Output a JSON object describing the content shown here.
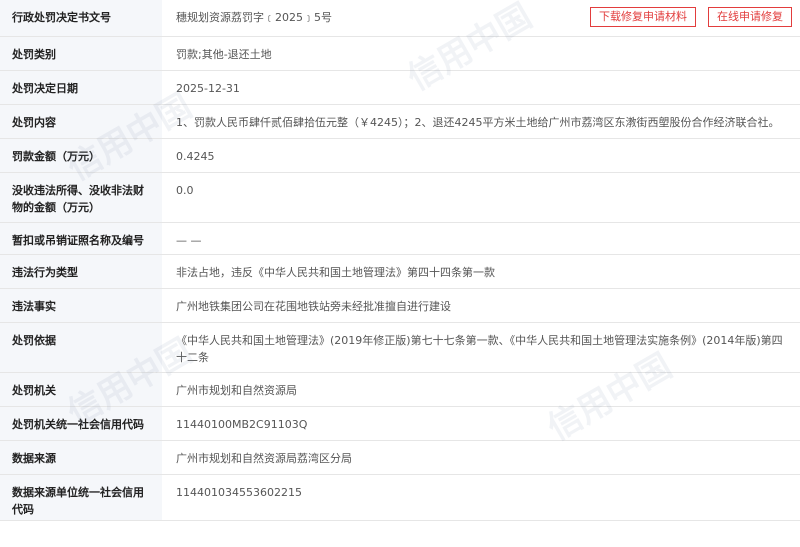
{
  "buttons": {
    "download_repair": "下载修复申请材料",
    "online_repair": "在线申请修复"
  },
  "rows": [
    {
      "label": "行政处罚决定书文号",
      "value": "穗规划资源荔罚字﹝2025﹞5号"
    },
    {
      "label": "处罚类别",
      "value": "罚款;其他-退还土地"
    },
    {
      "label": "处罚决定日期",
      "value": "2025-12-31"
    },
    {
      "label": "处罚内容",
      "value": "1、罚款人民币肆仟贰佰肆拾伍元整（￥4245）；2、退还4245平方米土地给广州市荔湾区东漖街西塱股份合作经济联合社。"
    },
    {
      "label": "罚款金额（万元）",
      "value": "0.4245"
    },
    {
      "label": "没收违法所得、没收非法财物的金额（万元）",
      "value": "0.0"
    },
    {
      "label": "暂扣或吊销证照名称及编号",
      "value": "— —"
    },
    {
      "label": "违法行为类型",
      "value": "非法占地，违反《中华人民共和国土地管理法》第四十四条第一款"
    },
    {
      "label": "违法事实",
      "value": "广州地铁集团公司在花围地铁站旁未经批准擅自进行建设"
    },
    {
      "label": "处罚依据",
      "value": "《中华人民共和国土地管理法》(2019年修正版)第七十七条第一款、《中华人民共和国土地管理法实施条例》(2014年版)第四十二条"
    },
    {
      "label": "处罚机关",
      "value": "广州市规划和自然资源局"
    },
    {
      "label": "处罚机关统一社会信用代码",
      "value": "11440100MB2C91103Q"
    },
    {
      "label": "数据来源",
      "value": "广州市规划和自然资源局荔湾区分局"
    },
    {
      "label": "数据来源单位统一社会信用代码",
      "value": "114401034553602215"
    }
  ],
  "watermark_text": "信用中国"
}
